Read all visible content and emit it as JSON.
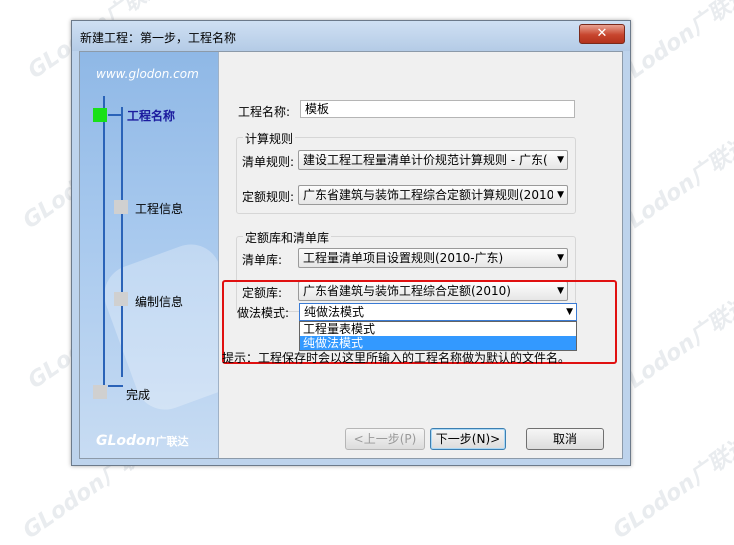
{
  "watermarks": [
    "GLodon广联达",
    "GLodon广联达",
    "GLodon广联达",
    "GLodon广联达",
    "GLodon广联达",
    "GLodon广联达",
    "GLodon广联达",
    "GLodon广联达"
  ],
  "window": {
    "title": "新建工程：第一步，工程名称",
    "close_symbol": "✕"
  },
  "sidebar": {
    "website": "www.glodon.com",
    "steps": [
      {
        "label": "工程名称",
        "active": true
      },
      {
        "label": "工程信息",
        "active": false
      },
      {
        "label": "编制信息",
        "active": false
      },
      {
        "label": "完成",
        "active": false
      }
    ],
    "brand": "GLodon",
    "brand_cn": "广联达"
  },
  "form": {
    "project_name_label": "工程名称:",
    "project_name_value": "模板",
    "calc_rules": {
      "title": "计算规则",
      "bill_rule_label": "清单规则:",
      "bill_rule_value": "建设工程工程量清单计价规范计算规则 - 广东(",
      "quota_rule_label": "定额规则:",
      "quota_rule_value": "广东省建筑与装饰工程综合定额计算规则(2010"
    },
    "libraries": {
      "title": "定额库和清单库",
      "bill_lib_label": "清单库:",
      "bill_lib_value": "工程量清单项目设置规则(2010-广东)",
      "quota_lib_label": "定额库:",
      "quota_lib_value": "广东省建筑与装饰工程综合定额(2010)"
    },
    "method": {
      "label": "做法模式:",
      "value": "纯做法模式",
      "options": [
        {
          "label": "工程量表模式",
          "selected": false
        },
        {
          "label": "纯做法模式",
          "selected": true
        }
      ]
    },
    "hint": "提示：工程保存时会以这里所输入的工程名称做为默认的文件名。"
  },
  "buttons": {
    "prev": "<上一步(P)",
    "next": "下一步(N)>",
    "cancel": "取消"
  },
  "colors": {
    "highlight": "#e01010",
    "active_step": "#19e019",
    "selection": "#3399ff"
  }
}
